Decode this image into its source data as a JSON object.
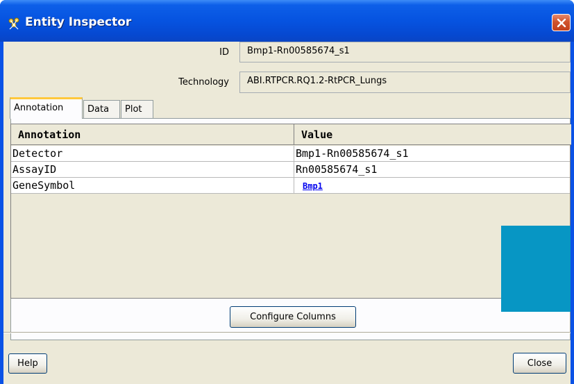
{
  "window": {
    "title": "Entity Inspector",
    "title_icon": "entity-inspector-icon",
    "close_icon": "close-icon"
  },
  "fields": {
    "id_label": "ID",
    "id_value": "Bmp1-Rn00585674_s1",
    "technology_label": "Technology",
    "technology_value": "ABI.RTPCR.RQ1.2-RtPCR_Lungs"
  },
  "tabs": [
    {
      "label": "Annotation",
      "active": true
    },
    {
      "label": "Data",
      "active": false
    },
    {
      "label": "Plot",
      "active": false
    }
  ],
  "table": {
    "columns": [
      "Annotation",
      "Value"
    ],
    "rows": [
      {
        "annotation": "Detector",
        "value": "Bmp1-Rn00585674_s1"
      },
      {
        "annotation": "AssayID",
        "value": "Rn00585674_s1"
      },
      {
        "annotation": "GeneSymbol",
        "value": "Bmp1"
      }
    ]
  },
  "buttons": {
    "configure_columns": "Configure Columns",
    "help": "Help",
    "close": "Close"
  },
  "colors": {
    "titlebar": "#0653e0",
    "client_bg": "#ece9d8",
    "active_tab_accent": "#ffc83c",
    "overlay_block": "#0796c4",
    "link": "#0000ee"
  }
}
